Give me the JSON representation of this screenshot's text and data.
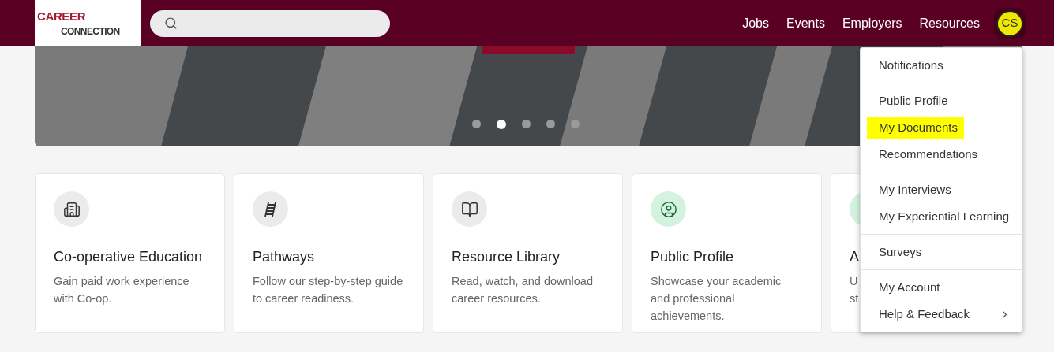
{
  "logo": {
    "line_1": "CAREER",
    "line_2": "CONNECTION"
  },
  "nav": [
    "Jobs",
    "Events",
    "Employers",
    "Resources"
  ],
  "avatar": {
    "initials": "CS"
  },
  "carousel": {
    "slides": [
      {
        "selected": false
      },
      {
        "selected": true
      },
      {
        "selected": false
      },
      {
        "selected": false
      },
      {
        "selected": false
      }
    ]
  },
  "cards": [
    {
      "kind": "building",
      "color": "#ebebeb",
      "title": "Co-operative Education",
      "description": [
        "Gain paid work experience",
        "with Co-op."
      ]
    },
    {
      "kind": "ladder",
      "color": "#ebebeb",
      "title": "Pathways",
      "description": [
        "Follow our step-by-step guide",
        "to career readiness."
      ]
    },
    {
      "kind": "reader",
      "color": "#ebebeb",
      "title": "Resource Library",
      "description": [
        "Read, watch, and download",
        "career resources."
      ]
    },
    {
      "kind": "profile",
      "color": "#d3f3df",
      "title": "Public Profile",
      "description": [
        "Showcase your academic",
        "and professional",
        "achievements."
      ]
    },
    {
      "kind": "cut",
      "color": "#d3f3df",
      "title": "A",
      "description": [
        "U",
        "st"
      ]
    }
  ],
  "menu": {
    "groups": [
      [
        {
          "label": "Notifications",
          "highlighted": false,
          "submenu": false
        }
      ],
      [
        {
          "label": "Public Profile",
          "highlighted": false,
          "submenu": false
        },
        {
          "label": "My Documents",
          "highlighted": true,
          "submenu": false
        },
        {
          "label": "Recommendations",
          "highlighted": false,
          "submenu": false
        }
      ],
      [
        {
          "label": "My Interviews",
          "highlighted": false,
          "submenu": false
        },
        {
          "label": "My Experiential Learning",
          "highlighted": false,
          "submenu": false
        }
      ],
      [
        {
          "label": "Surveys",
          "highlighted": false,
          "submenu": false
        }
      ],
      [
        {
          "label": "My Account",
          "highlighted": false,
          "submenu": false
        },
        {
          "label": "Help & Feedback",
          "highlighted": false,
          "submenu": true
        }
      ]
    ]
  }
}
